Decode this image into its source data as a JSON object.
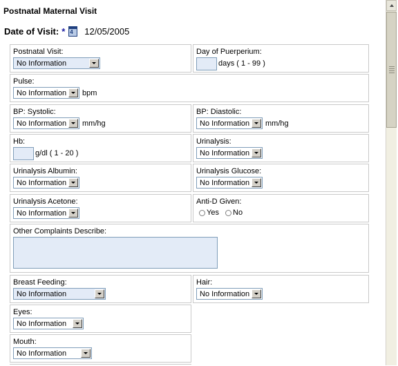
{
  "title": "Postnatal Maternal Visit",
  "date_of_visit": {
    "label": "Date of Visit:",
    "required": "*",
    "value": "12/05/2005",
    "calendar_icon": "calendar-icon",
    "calendar_digit": "4"
  },
  "fields": {
    "postnatal_visit": {
      "label": "Postnatal Visit:",
      "value": "No Information"
    },
    "day_of_puerperium": {
      "label": "Day of Puerperium:",
      "unit": "days ( 1 - 99 )"
    },
    "pulse": {
      "label": "Pulse:",
      "value": "No Information",
      "unit": "bpm"
    },
    "bp_systolic": {
      "label": "BP: Systolic:",
      "value": "No Information",
      "unit": "mm/hg"
    },
    "bp_diastolic": {
      "label": "BP: Diastolic:",
      "value": "No Information",
      "unit": "mm/hg"
    },
    "hb": {
      "label": "Hb:",
      "unit": "g/dl ( 1 - 20 )"
    },
    "urinalysis": {
      "label": "Urinalysis:",
      "value": "No Information"
    },
    "urinalysis_albumin": {
      "label": "Urinalysis Albumin:",
      "value": "No Information"
    },
    "urinalysis_glucose": {
      "label": "Urinalysis Glucose:",
      "value": "No Information"
    },
    "urinalysis_acetone": {
      "label": "Urinalysis Acetone:",
      "value": "No Information"
    },
    "anti_d_given": {
      "label": "Anti-D Given:",
      "yes": "Yes",
      "no": "No"
    },
    "other_complaints": {
      "label": "Other Complaints Describe:"
    },
    "breast_feeding": {
      "label": "Breast Feeding:",
      "value": "No Information"
    },
    "hair": {
      "label": "Hair:",
      "value": "No Information"
    },
    "eyes": {
      "label": "Eyes:",
      "value": "No Information"
    },
    "mouth": {
      "label": "Mouth:",
      "value": "No Information"
    }
  }
}
